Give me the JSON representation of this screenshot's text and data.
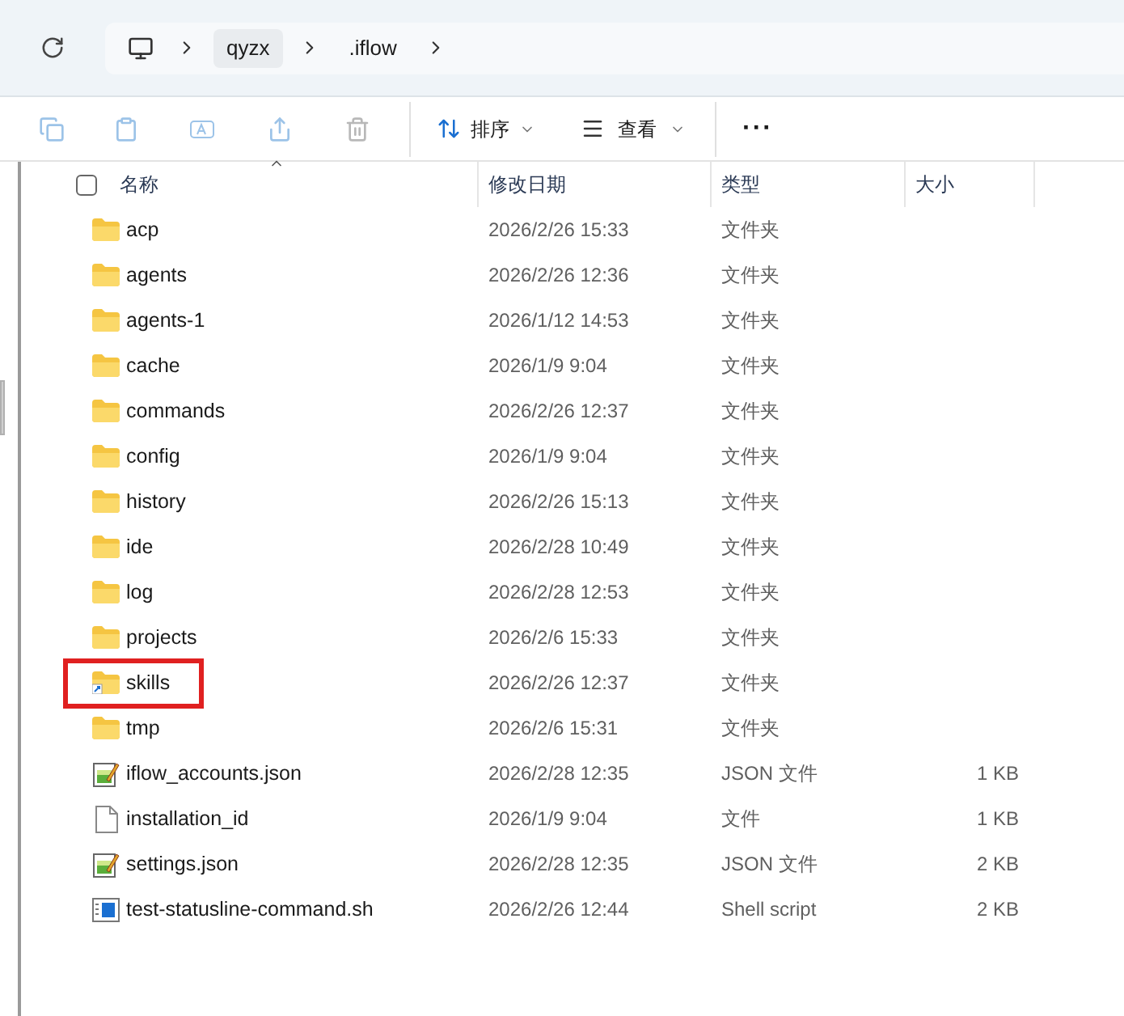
{
  "breadcrumb": {
    "items": [
      {
        "kind": "computer"
      },
      {
        "kind": "text",
        "label": "qyzx",
        "selected": true
      },
      {
        "kind": "text",
        "label": ".iflow",
        "selected": false
      }
    ]
  },
  "toolbar": {
    "sort": {
      "label": "排序"
    },
    "view": {
      "label": "查看"
    },
    "more": {
      "label": "···"
    }
  },
  "table": {
    "select_all": {
      "checked": false
    },
    "columns": [
      "名称",
      "修改日期",
      "类型",
      "大小"
    ],
    "rows": [
      {
        "kind": "folder",
        "name": "acp",
        "date": "2026/2/26 15:33",
        "type": "文件夹",
        "highlighted": false
      },
      {
        "kind": "folder",
        "name": "agents",
        "date": "2026/2/26 12:36",
        "type": "文件夹",
        "highlighted": false
      },
      {
        "kind": "folder",
        "name": "agents-1",
        "date": "2026/1/12 14:53",
        "type": "文件夹",
        "highlighted": false
      },
      {
        "kind": "folder",
        "name": "cache",
        "date": "2026/1/9 9:04",
        "type": "文件夹",
        "highlighted": false
      },
      {
        "kind": "folder",
        "name": "commands",
        "date": "2026/2/26 12:37",
        "type": "文件夹",
        "highlighted": false
      },
      {
        "kind": "folder",
        "name": "config",
        "date": "2026/1/9 9:04",
        "type": "文件夹",
        "highlighted": false
      },
      {
        "kind": "folder",
        "name": "history",
        "date": "2026/2/26 15:13",
        "type": "文件夹",
        "highlighted": false
      },
      {
        "kind": "folder",
        "name": "ide",
        "date": "2026/2/28 10:49",
        "type": "文件夹",
        "highlighted": false
      },
      {
        "kind": "folder",
        "name": "log",
        "date": "2026/2/28 12:53",
        "type": "文件夹",
        "highlighted": false
      },
      {
        "kind": "folder",
        "name": "projects",
        "date": "2026/2/6 15:33",
        "type": "文件夹",
        "highlighted": false
      },
      {
        "kind": "link",
        "name": "skills",
        "date": "2026/2/26 12:37",
        "type": "文件夹",
        "highlighted": true
      },
      {
        "kind": "folder",
        "name": "tmp",
        "date": "2026/2/6 15:31",
        "type": "文件夹",
        "highlighted": false
      },
      {
        "kind": "json",
        "name": "iflow_accounts.json",
        "date": "2026/2/28 12:35",
        "type": "JSON 文件",
        "size": "1 KB",
        "highlighted": false
      },
      {
        "kind": "file",
        "name": "installation_id",
        "date": "2026/1/9 9:04",
        "type": "文件",
        "size": "1 KB",
        "highlighted": false
      },
      {
        "kind": "json",
        "name": "settings.json",
        "date": "2026/2/28 12:35",
        "type": "JSON 文件",
        "size": "2 KB",
        "highlighted": false
      },
      {
        "kind": "shell",
        "name": "test-statusline-command.sh",
        "date": "2026/2/26 12:44",
        "type": "Shell script",
        "size": "2 KB",
        "highlighted": false
      }
    ]
  }
}
